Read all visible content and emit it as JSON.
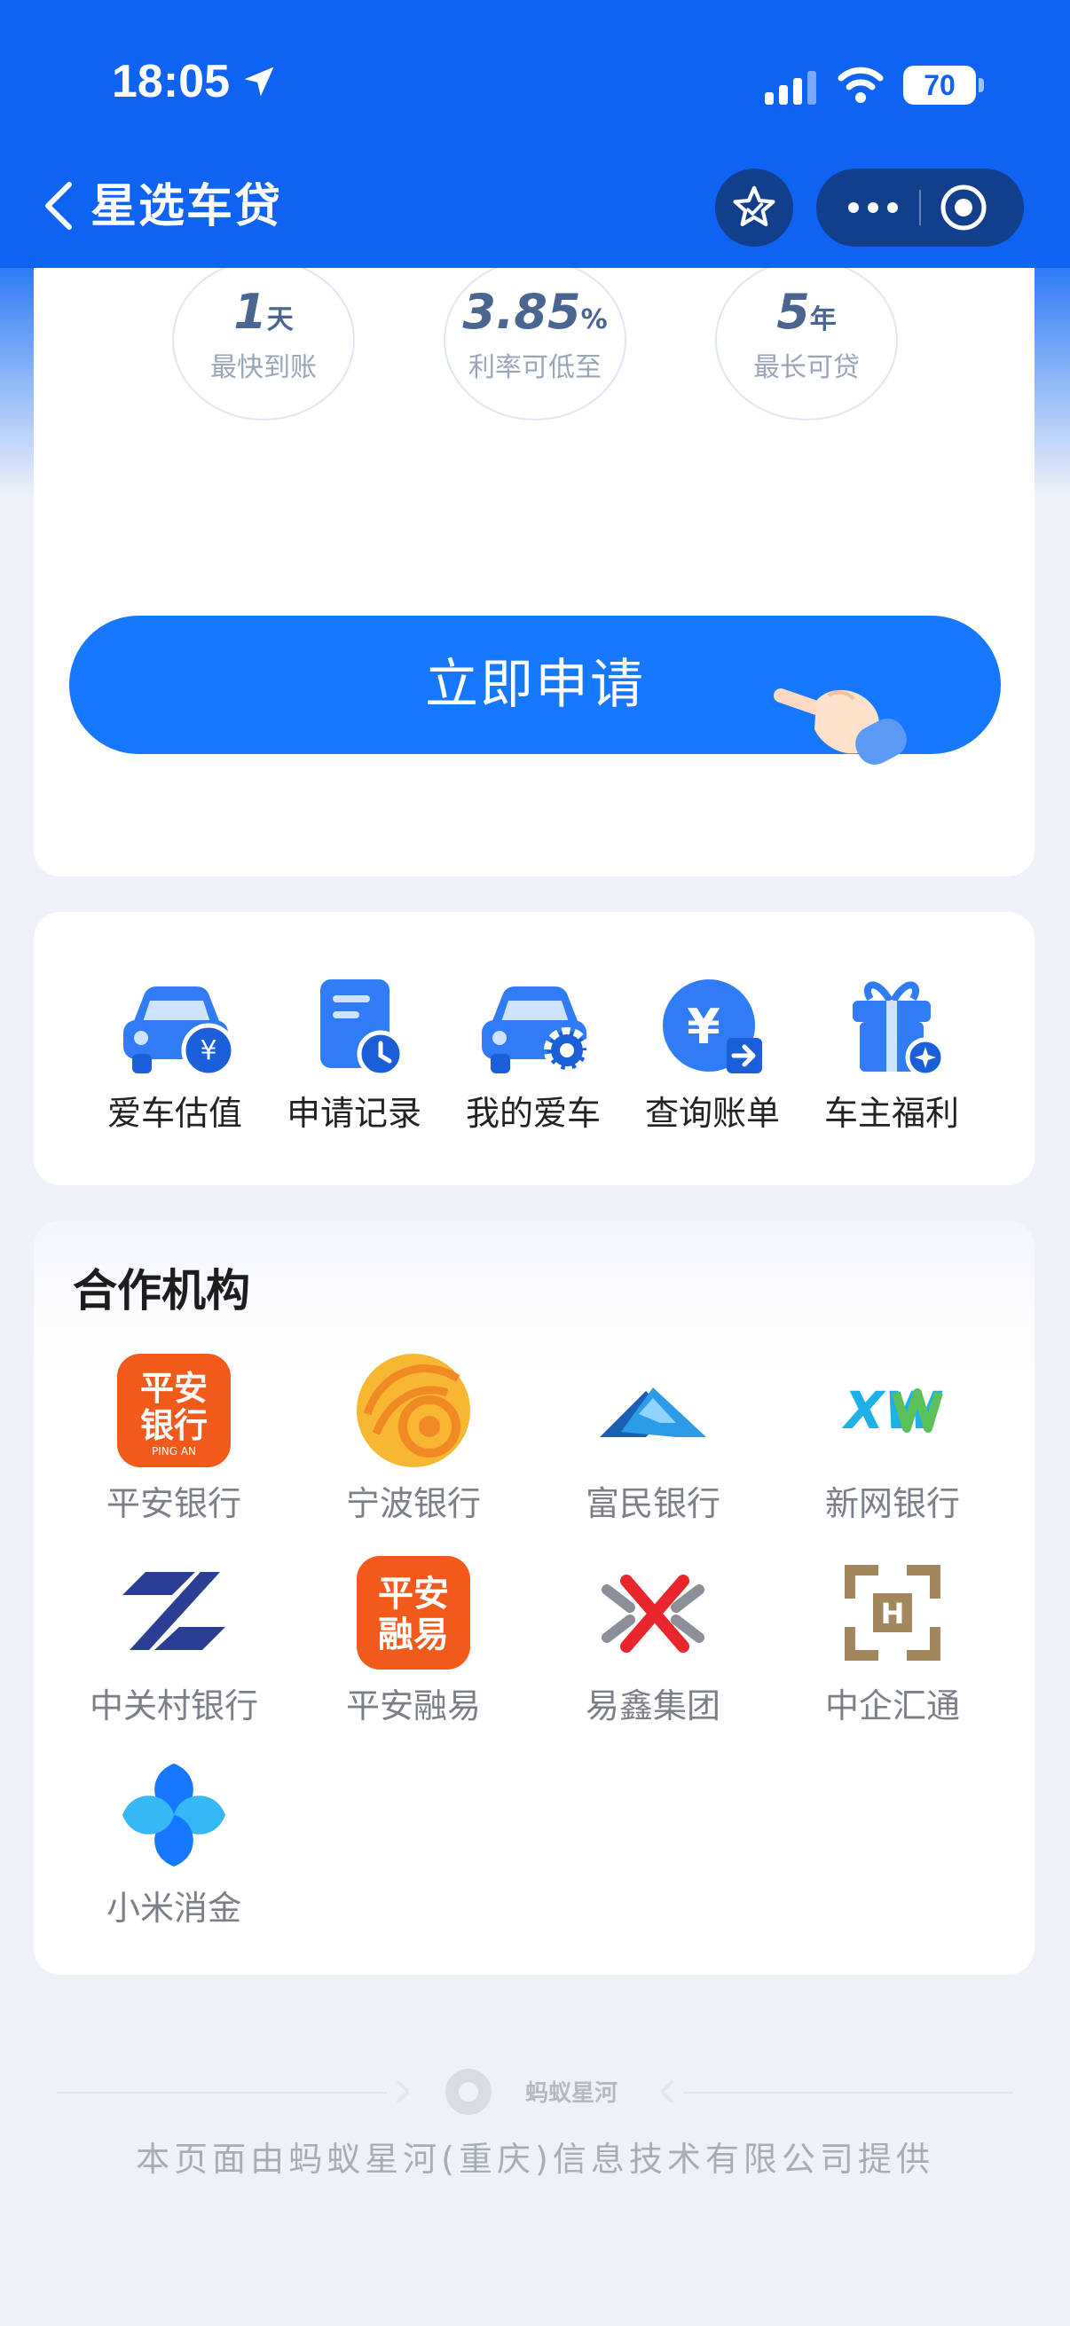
{
  "status_bar": {
    "time": "18:05",
    "battery": "70"
  },
  "header": {
    "title": "星选车贷"
  },
  "hero": {
    "stats": [
      {
        "value": "1",
        "unit": "天",
        "label": "最快到账"
      },
      {
        "value": "3.85",
        "unit": "%",
        "label": "利率可低至"
      },
      {
        "value": "5",
        "unit": "年",
        "label": "最长可贷"
      }
    ],
    "apply_label": "立即申请"
  },
  "services": [
    {
      "label": "爱车估值",
      "icon": "car-valuation-icon"
    },
    {
      "label": "申请记录",
      "icon": "application-record-icon"
    },
    {
      "label": "我的爱车",
      "icon": "my-car-icon"
    },
    {
      "label": "查询账单",
      "icon": "bill-query-icon"
    },
    {
      "label": "车主福利",
      "icon": "gift-icon"
    }
  ],
  "partners": {
    "title": "合作机构",
    "items": [
      {
        "label": "平安银行",
        "logo_text": [
          "平安",
          "银行",
          "PING AN"
        ]
      },
      {
        "label": "宁波银行"
      },
      {
        "label": "富民银行"
      },
      {
        "label": "新网银行",
        "logo_text": "XW"
      },
      {
        "label": "中关村银行"
      },
      {
        "label": "平安融易",
        "logo_text": [
          "平安",
          "融易"
        ]
      },
      {
        "label": "易鑫集团"
      },
      {
        "label": "中企汇通",
        "logo_text": "H"
      },
      {
        "label": "小米消金"
      }
    ]
  },
  "footer": {
    "logo_text": "蚂蚁星河",
    "text": "本页面由蚂蚁星河(重庆)信息技术有限公司提供"
  },
  "colors": {
    "brand_blue": "#0f63f2",
    "button_blue": "#1677ff"
  }
}
